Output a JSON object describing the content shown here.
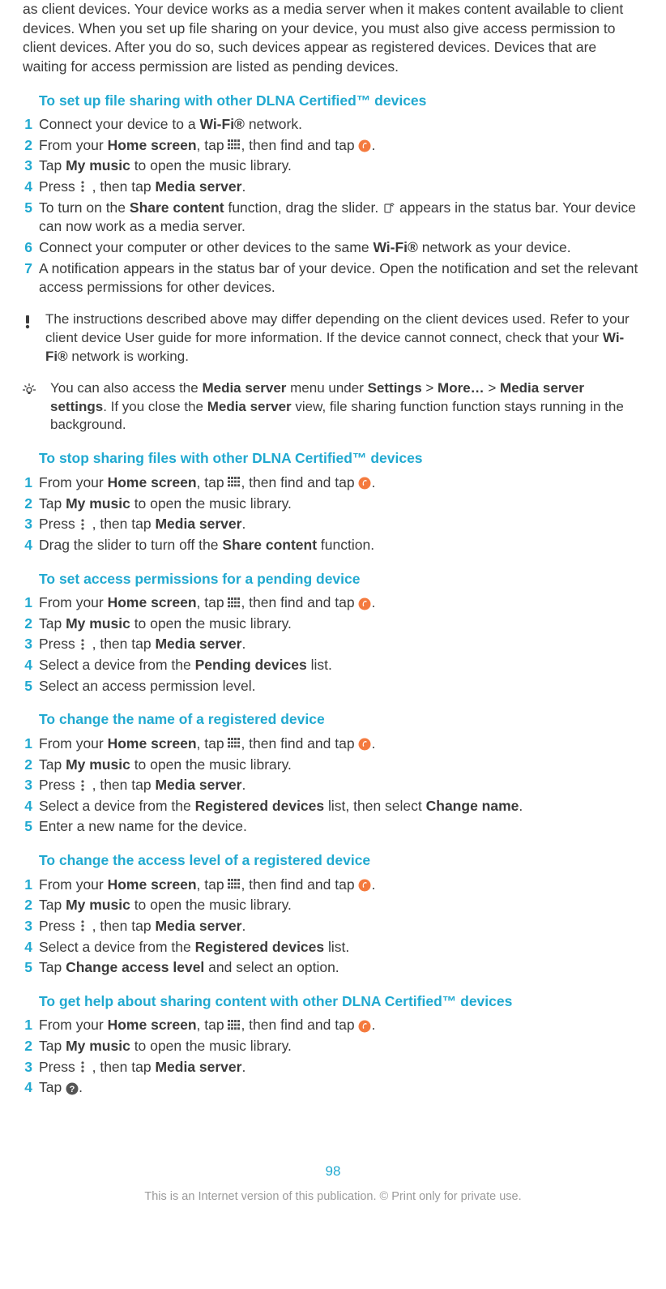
{
  "intro": "as client devices. Your device works as a media server when it makes content available to client devices. When you set up file sharing on your device, you must also give access permission to client devices. After you do so, such devices appear as registered devices. Devices that are waiting for access permission are listed as pending devices.",
  "sections": [
    {
      "heading": "To set up file sharing with other DLNA Certified™ devices",
      "steps": [
        [
          {
            "t": "Connect your device to a "
          },
          {
            "b": "Wi-Fi®"
          },
          {
            "t": " network."
          }
        ],
        [
          {
            "t": "From your "
          },
          {
            "b": "Home screen"
          },
          {
            "t": ", tap "
          },
          {
            "i": "apps"
          },
          {
            "t": ", then find and tap "
          },
          {
            "i": "walkman"
          },
          {
            "t": "."
          }
        ],
        [
          {
            "t": "Tap "
          },
          {
            "b": "My music"
          },
          {
            "t": " to open the music library."
          }
        ],
        [
          {
            "t": "Press "
          },
          {
            "i": "menu"
          },
          {
            "t": ", then tap "
          },
          {
            "b": "Media server"
          },
          {
            "t": "."
          }
        ],
        [
          {
            "t": "To turn on the "
          },
          {
            "b": "Share content"
          },
          {
            "t": " function, drag the slider. "
          },
          {
            "i": "share"
          },
          {
            "t": " appears in the status bar. Your device can now work as a media server."
          }
        ],
        [
          {
            "t": "Connect your computer or other devices to the same "
          },
          {
            "b": "Wi-Fi®"
          },
          {
            "t": " network as your device."
          }
        ],
        [
          {
            "t": "A notification appears in the status bar of your device. Open the notification and set the relevant access permissions for other devices."
          }
        ]
      ]
    },
    {
      "heading": "To stop sharing files with other DLNA Certified™ devices",
      "steps": [
        [
          {
            "t": "From your "
          },
          {
            "b": "Home screen"
          },
          {
            "t": ", tap "
          },
          {
            "i": "apps"
          },
          {
            "t": ", then find and tap "
          },
          {
            "i": "walkman"
          },
          {
            "t": "."
          }
        ],
        [
          {
            "t": "Tap "
          },
          {
            "b": "My music"
          },
          {
            "t": " to open the music library."
          }
        ],
        [
          {
            "t": "Press "
          },
          {
            "i": "menu"
          },
          {
            "t": ", then tap "
          },
          {
            "b": "Media server"
          },
          {
            "t": "."
          }
        ],
        [
          {
            "t": "Drag the slider to turn off the "
          },
          {
            "b": "Share content"
          },
          {
            "t": " function."
          }
        ]
      ]
    },
    {
      "heading": "To set access permissions for a pending device",
      "steps": [
        [
          {
            "t": "From your "
          },
          {
            "b": "Home screen"
          },
          {
            "t": ", tap "
          },
          {
            "i": "apps"
          },
          {
            "t": ", then find and tap "
          },
          {
            "i": "walkman"
          },
          {
            "t": "."
          }
        ],
        [
          {
            "t": "Tap "
          },
          {
            "b": "My music"
          },
          {
            "t": " to open the music library."
          }
        ],
        [
          {
            "t": "Press "
          },
          {
            "i": "menu"
          },
          {
            "t": ", then tap "
          },
          {
            "b": "Media server"
          },
          {
            "t": "."
          }
        ],
        [
          {
            "t": "Select a device from the "
          },
          {
            "b": "Pending devices"
          },
          {
            "t": " list."
          }
        ],
        [
          {
            "t": "Select an access permission level."
          }
        ]
      ]
    },
    {
      "heading": "To change the name of a registered device",
      "steps": [
        [
          {
            "t": "From your "
          },
          {
            "b": "Home screen"
          },
          {
            "t": ", tap "
          },
          {
            "i": "apps"
          },
          {
            "t": ", then find and tap "
          },
          {
            "i": "walkman"
          },
          {
            "t": "."
          }
        ],
        [
          {
            "t": "Tap "
          },
          {
            "b": "My music"
          },
          {
            "t": " to open the music library."
          }
        ],
        [
          {
            "t": "Press "
          },
          {
            "i": "menu"
          },
          {
            "t": ", then tap "
          },
          {
            "b": "Media server"
          },
          {
            "t": "."
          }
        ],
        [
          {
            "t": "Select a device from the "
          },
          {
            "b": "Registered devices"
          },
          {
            "t": " list, then select "
          },
          {
            "b": "Change name"
          },
          {
            "t": "."
          }
        ],
        [
          {
            "t": "Enter a new name for the device."
          }
        ]
      ]
    },
    {
      "heading": "To change the access level of a registered device",
      "steps": [
        [
          {
            "t": "From your "
          },
          {
            "b": "Home screen"
          },
          {
            "t": ", tap "
          },
          {
            "i": "apps"
          },
          {
            "t": ", then find and tap "
          },
          {
            "i": "walkman"
          },
          {
            "t": "."
          }
        ],
        [
          {
            "t": "Tap "
          },
          {
            "b": "My music"
          },
          {
            "t": " to open the music library."
          }
        ],
        [
          {
            "t": "Press "
          },
          {
            "i": "menu"
          },
          {
            "t": ", then tap "
          },
          {
            "b": "Media server"
          },
          {
            "t": "."
          }
        ],
        [
          {
            "t": "Select a device from the "
          },
          {
            "b": "Registered devices"
          },
          {
            "t": " list."
          }
        ],
        [
          {
            "t": "Tap "
          },
          {
            "b": "Change access level"
          },
          {
            "t": " and select an option."
          }
        ]
      ]
    },
    {
      "heading": "To get help about sharing content with other DLNA Certified™ devices",
      "steps": [
        [
          {
            "t": "From your "
          },
          {
            "b": "Home screen"
          },
          {
            "t": ", tap "
          },
          {
            "i": "apps"
          },
          {
            "t": ", then find and tap "
          },
          {
            "i": "walkman"
          },
          {
            "t": "."
          }
        ],
        [
          {
            "t": "Tap "
          },
          {
            "b": "My music"
          },
          {
            "t": " to open the music library."
          }
        ],
        [
          {
            "t": "Press "
          },
          {
            "i": "menu"
          },
          {
            "t": ", then tap "
          },
          {
            "b": "Media server"
          },
          {
            "t": "."
          }
        ],
        [
          {
            "t": "Tap "
          },
          {
            "i": "help"
          },
          {
            "t": "."
          }
        ]
      ]
    }
  ],
  "warning_after_section_index": 0,
  "warning": [
    {
      "t": "The instructions described above may differ depending on the client devices used. Refer to your client device User guide for more information. If the device cannot connect, check that your "
    },
    {
      "b": "Wi-Fi®"
    },
    {
      "t": " network is working."
    }
  ],
  "tip": [
    {
      "t": "You can also access the "
    },
    {
      "b": "Media server"
    },
    {
      "t": " menu under "
    },
    {
      "b": "Settings"
    },
    {
      "t": " > "
    },
    {
      "b": "More…"
    },
    {
      "t": " > "
    },
    {
      "b": "Media server settings"
    },
    {
      "t": ". If you close the "
    },
    {
      "b": "Media server"
    },
    {
      "t": " view, file sharing function function stays running in the background."
    }
  ],
  "page_number": "98",
  "copyright": "This is an Internet version of this publication. © Print only for private use."
}
